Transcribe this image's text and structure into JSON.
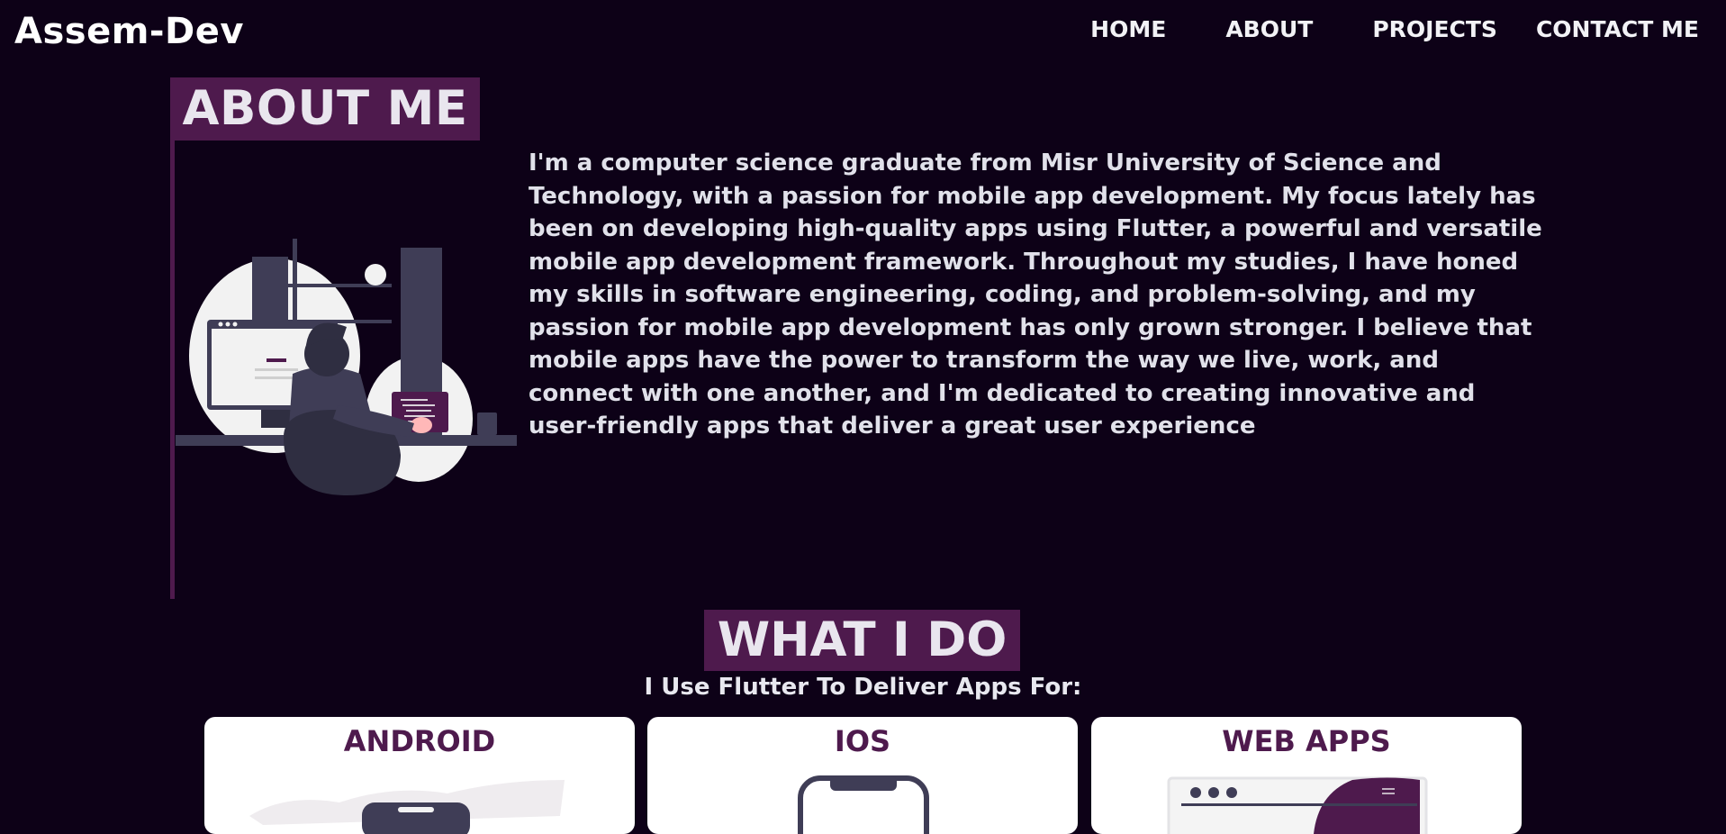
{
  "header": {
    "logo": "Assem-Dev",
    "nav": [
      "HOME",
      "ABOUT",
      "PROJECTS",
      "CONTACT ME"
    ]
  },
  "about": {
    "heading": "ABOUT ME",
    "paragraph": "I'm a computer science graduate from Misr University of Science and Technology, with a passion for mobile app development. My focus lately has been on developing high-quality apps using Flutter, a powerful and versatile mobile app development framework. Throughout my studies, I have honed my skills in software engineering, coding, and problem-solving, and my passion for mobile app development has only grown stronger. I believe that mobile apps have the power to transform the way we live, work, and connect with one another, and I'm dedicated to creating innovative and user-friendly apps that deliver a great user experience",
    "illustration_icon": "developer-at-desk-illustration"
  },
  "whatido": {
    "heading": "WHAT I DO",
    "subtitle": "I Use Flutter To Deliver Apps For:",
    "cards": [
      {
        "title": "ANDROID",
        "icon": "android-phone-icon"
      },
      {
        "title": "IOS",
        "icon": "iphone-icon"
      },
      {
        "title": "WEB APPS",
        "icon": "browser-window-icon"
      }
    ]
  },
  "colors": {
    "background": "#0d0117",
    "accent": "#4e1a4d",
    "text": "#e1e1ea",
    "card": "#ffffff"
  }
}
